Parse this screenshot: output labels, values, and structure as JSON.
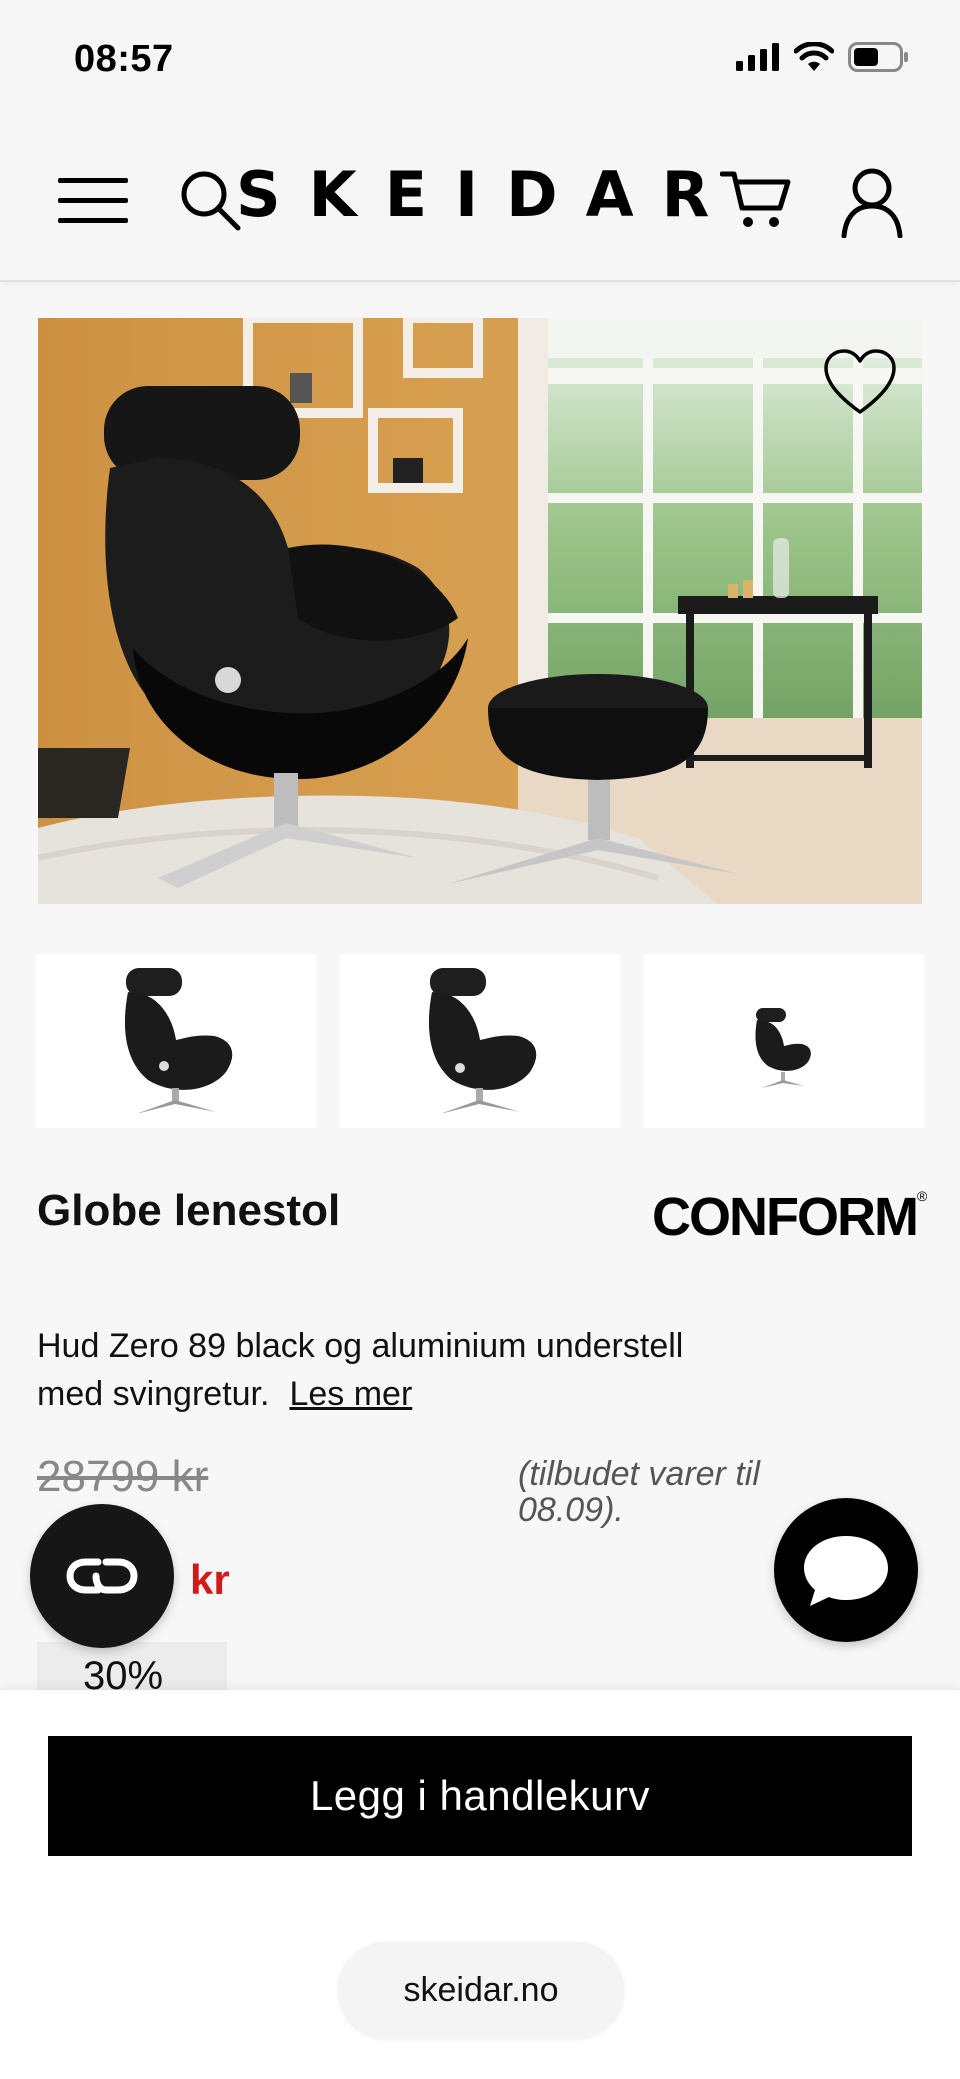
{
  "status_bar": {
    "time": "08:57",
    "icons": [
      "cellular-signal-icon",
      "wifi-icon",
      "battery-icon"
    ]
  },
  "header": {
    "logo": "SKEIDAR",
    "menu_icon": "hamburger-menu-icon",
    "search_icon": "search-icon",
    "cart_icon": "cart-icon",
    "account_icon": "user-icon"
  },
  "gallery": {
    "favorite_icon": "heart-outline-icon",
    "thumbnails": [
      "chair-front",
      "chair-angle",
      "chair-small"
    ]
  },
  "product": {
    "title": "Globe lenestol",
    "brand": "CONFORM",
    "brand_mark": "®",
    "description": "Hud Zero 89 black og aluminium understell med svingretur.",
    "read_more": "Les mer",
    "old_price": "28799 kr",
    "offer_note": "(tilbudet varer til 08.09).",
    "new_price_suffix": "kr",
    "discount": "30%"
  },
  "floating": {
    "left_icon": "link-loop-icon",
    "right_icon": "chat-bubble-icon"
  },
  "bottom_bar": {
    "add_to_cart": "Legg i handlekurv",
    "url": "skeidar.no"
  },
  "colors": {
    "accent": "#000000",
    "sale_price": "#d31a1a",
    "background": "#f7f7f7"
  }
}
